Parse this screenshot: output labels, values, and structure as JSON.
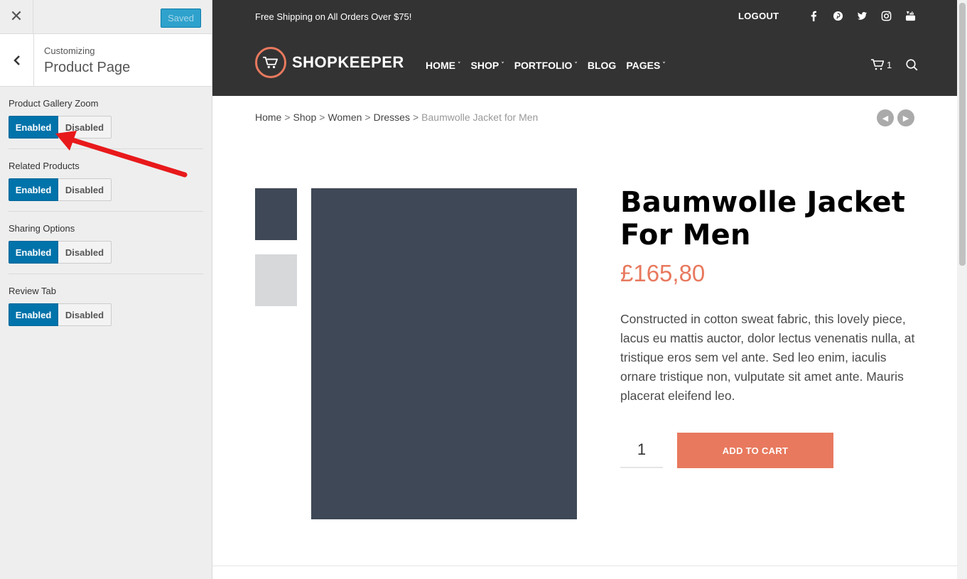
{
  "customizer": {
    "close_glyph": "✕",
    "saved_label": "Saved",
    "breadcrumb_small": "Customizing",
    "section_title": "Product Page",
    "settings": [
      {
        "label": "Product Gallery Zoom",
        "enabled_label": "Enabled",
        "disabled_label": "Disabled",
        "value": "Enabled"
      },
      {
        "label": "Related Products",
        "enabled_label": "Enabled",
        "disabled_label": "Disabled",
        "value": "Enabled"
      },
      {
        "label": "Sharing Options",
        "enabled_label": "Enabled",
        "disabled_label": "Disabled",
        "value": "Enabled"
      },
      {
        "label": "Review Tab",
        "enabled_label": "Enabled",
        "disabled_label": "Disabled",
        "value": "Enabled"
      }
    ],
    "annotation_arrow_color": "#e8191b"
  },
  "site": {
    "topbar_text": "Free Shipping on All Orders Over $75!",
    "logout_label": "LOGOUT",
    "socials": [
      "facebook-icon",
      "pinterest-icon",
      "twitter-icon",
      "instagram-icon",
      "youtube-icon"
    ],
    "logo_text": "SHOPKEEPER",
    "nav": [
      {
        "label": "HOME",
        "dropdown": true
      },
      {
        "label": "SHOP",
        "dropdown": true
      },
      {
        "label": "PORTFOLIO",
        "dropdown": true
      },
      {
        "label": "BLOG",
        "dropdown": false
      },
      {
        "label": "PAGES",
        "dropdown": true
      }
    ],
    "cart_count": "1",
    "breadcrumb": [
      "Home",
      "Shop",
      "Women",
      "Dresses"
    ],
    "breadcrumb_sep": ">",
    "breadcrumb_current": "Baumwolle Jacket for Men",
    "product": {
      "title": "Baumwolle Jacket For Men",
      "price": "£165,80",
      "description": "Constructed in cotton sweat fabric, this lovely piece, lacus eu mattis auctor, dolor lectus venenatis nulla, at tristique eros sem vel ante. Sed leo enim, iaculis ornare tristique non, vulputate sit amet ante. Mauris placerat eleifend leo.",
      "quantity": "1",
      "add_to_cart_label": "ADD TO CART"
    },
    "colors": {
      "header_bg": "#333333",
      "accent": "#e8795e",
      "image_dark": "#3e4856",
      "image_light": "#d7d8da",
      "toggle_on": "#0073aa"
    }
  }
}
